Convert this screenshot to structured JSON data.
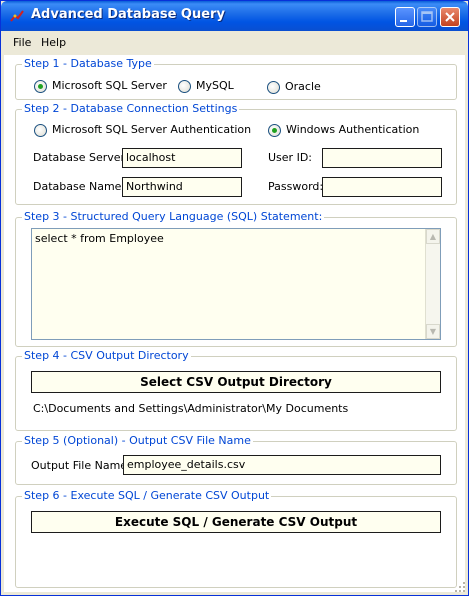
{
  "window": {
    "title": "Advanced Database Query"
  },
  "menu": {
    "items": [
      "File",
      "Help"
    ]
  },
  "step1": {
    "legend": "Step 1 - Database Type",
    "options": [
      {
        "label": "Microsoft SQL Server",
        "checked": true
      },
      {
        "label": "MySQL",
        "checked": false
      },
      {
        "label": "Oracle",
        "checked": false
      }
    ]
  },
  "step2": {
    "legend": "Step 2 - Database Connection Settings",
    "auth_options": [
      {
        "label": "Microsoft SQL Server Authentication",
        "checked": false
      },
      {
        "label": "Windows Authentication",
        "checked": true
      }
    ],
    "server_label": "Database Server:",
    "server_value": "localhost",
    "dbname_label": "Database Name:",
    "dbname_value": "Northwind",
    "userid_label": "User ID:",
    "userid_value": "",
    "password_label": "Password:",
    "password_value": ""
  },
  "step3": {
    "legend": "Step 3 - Structured Query Language (SQL) Statement:",
    "sql": "select * from Employee"
  },
  "step4": {
    "legend": "Step 4 - CSV Output Directory",
    "button_label": "Select CSV Output Directory",
    "path": "C:\\Documents and Settings\\Administrator\\My Documents"
  },
  "step5": {
    "legend": "Step 5 (Optional) - Output CSV File Name",
    "label": "Output File Name:",
    "value": "employee_details.csv"
  },
  "step6": {
    "legend": "Step 6 - Execute SQL / Generate CSV Output",
    "button_label": "Execute SQL / Generate CSV Output"
  },
  "colors": {
    "title_bar": "#0054e3",
    "group_legend": "#0046d5",
    "field_background": "#fffff0",
    "radio_checked": "#21a121"
  }
}
